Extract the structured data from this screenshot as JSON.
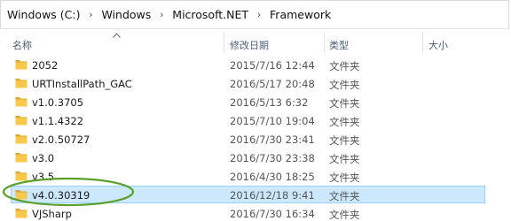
{
  "breadcrumb": {
    "items": [
      "Windows (C:)",
      "Windows",
      "Microsoft.NET",
      "Framework"
    ],
    "separator": "›"
  },
  "columns": {
    "name": "名称",
    "modified": "修改日期",
    "type": "类型",
    "size": "大小"
  },
  "files": [
    {
      "name": "2052",
      "modified": "2015/7/16 12:44",
      "type": "文件夹"
    },
    {
      "name": "URTInstallPath_GAC",
      "modified": "2016/5/17 20:48",
      "type": "文件夹"
    },
    {
      "name": "v1.0.3705",
      "modified": "2016/5/13 6:32",
      "type": "文件夹"
    },
    {
      "name": "v1.1.4322",
      "modified": "2015/7/10 19:04",
      "type": "文件夹"
    },
    {
      "name": "v2.0.50727",
      "modified": "2016/7/30 23:41",
      "type": "文件夹"
    },
    {
      "name": "v3.0",
      "modified": "2016/7/30 23:38",
      "type": "文件夹"
    },
    {
      "name": "v3.5",
      "modified": "2016/4/30 18:25",
      "type": "文件夹"
    },
    {
      "name": "v4.0.30319",
      "modified": "2016/12/18 9:41",
      "type": "文件夹",
      "selected": true
    },
    {
      "name": "VJSharp",
      "modified": "2016/7/30 16:34",
      "type": "文件夹"
    }
  ],
  "colors": {
    "folder": "#f7c84a",
    "selection": "#cce8ff",
    "annotation": "#5aa02c"
  },
  "icons": {
    "folder": "folder-icon",
    "sort": "sort-ascending-icon",
    "breadcrumb_separator": "chevron-right-icon"
  }
}
